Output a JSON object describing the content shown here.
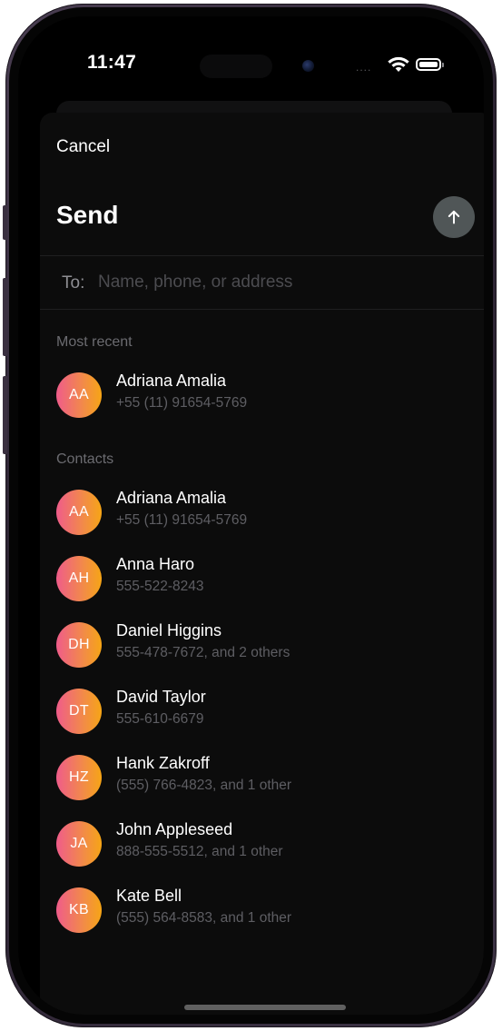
{
  "status_bar": {
    "time": "11:47",
    "signal_dots": "....",
    "icons": [
      "wifi-icon",
      "battery-icon"
    ]
  },
  "sheet": {
    "cancel_label": "Cancel",
    "title": "Send",
    "send_icon": "arrow-up-icon"
  },
  "recipient": {
    "label": "To:",
    "placeholder": "Name, phone, or address",
    "value": ""
  },
  "most_recent": {
    "header": "Most recent",
    "items": [
      {
        "initials": "AA",
        "name": "Adriana Amalia",
        "detail": "+55 (11) 91654-5769"
      }
    ]
  },
  "contacts": {
    "header": "Contacts",
    "items": [
      {
        "initials": "AA",
        "name": "Adriana Amalia",
        "detail": "+55 (11) 91654-5769"
      },
      {
        "initials": "AH",
        "name": "Anna Haro",
        "detail": "555-522-8243"
      },
      {
        "initials": "DH",
        "name": "Daniel Higgins",
        "detail": "555-478-7672, and 2 others"
      },
      {
        "initials": "DT",
        "name": "David Taylor",
        "detail": "555-610-6679"
      },
      {
        "initials": "HZ",
        "name": "Hank Zakroff",
        "detail": "(555) 766-4823, and 1 other"
      },
      {
        "initials": "JA",
        "name": "John Appleseed",
        "detail": "888-555-5512, and 1 other"
      },
      {
        "initials": "KB",
        "name": "Kate Bell",
        "detail": "(555) 564-8583, and 1 other"
      }
    ]
  },
  "colors": {
    "avatar_gradient_start": "#ef5c8a",
    "avatar_gradient_end": "#f6a515",
    "send_button": "#505657",
    "sheet_background": "#0c0c0c"
  }
}
